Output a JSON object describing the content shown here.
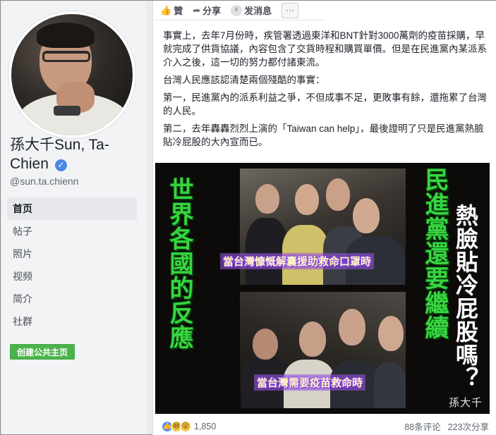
{
  "profile": {
    "name": "孫大千Sun, Ta-Chien",
    "name_line1": "孫大千Sun, Ta-",
    "name_line2": "Chien",
    "handle": "@sun.ta.chienn",
    "verified_icon": "verified-check-icon"
  },
  "nav": {
    "items": [
      {
        "label": "首页",
        "active": true
      },
      {
        "label": "帖子",
        "active": false
      },
      {
        "label": "照片",
        "active": false
      },
      {
        "label": "视频",
        "active": false
      },
      {
        "label": "简介",
        "active": false
      },
      {
        "label": "社群",
        "active": false
      }
    ],
    "create_page_label": "创建公共主页"
  },
  "post_actions": {
    "like_label": "贊",
    "share_label": "分享",
    "message_label": "发消息",
    "more_label": "···"
  },
  "post": {
    "paragraphs": [
      "事實上，去年7月份時，疾管署透過東洋和BNT針對3000萬劑的疫苗採購，早就完成了供貨協議，內容包含了交貨時程和購買單價。但是在民進黨內某派系介入之後，這一切的努力都付諸東流。",
      "台灣人民應該認清楚兩個殘酷的事實：",
      "第一，民進黨內的派系利益之爭，不但成事不足，更敗事有餘，還拖累了台灣的人民。",
      "第二，去年轟轟烈烈上演的「Taiwan can help」，最後證明了只是民進黨熱臉貼冷屁股的大內宣而已。"
    ]
  },
  "meme": {
    "left_text": "世界各國的反應",
    "middle_text": "民進黨還要繼續",
    "right_text": "熱臉貼冷屁股嗎？",
    "caption_top": "當台灣慷慨解囊援助救命口罩時",
    "caption_bottom": "當台灣需要疫苗救命時",
    "signature": "孫大千"
  },
  "footer": {
    "reaction_count": "1,850",
    "comments": "88条评论",
    "shares": "223次分享"
  },
  "colors": {
    "accent": "#4b88e6",
    "create_button": "#4bb34b",
    "meme_green": "#37d640",
    "caption_glow": "#8a3cff"
  }
}
